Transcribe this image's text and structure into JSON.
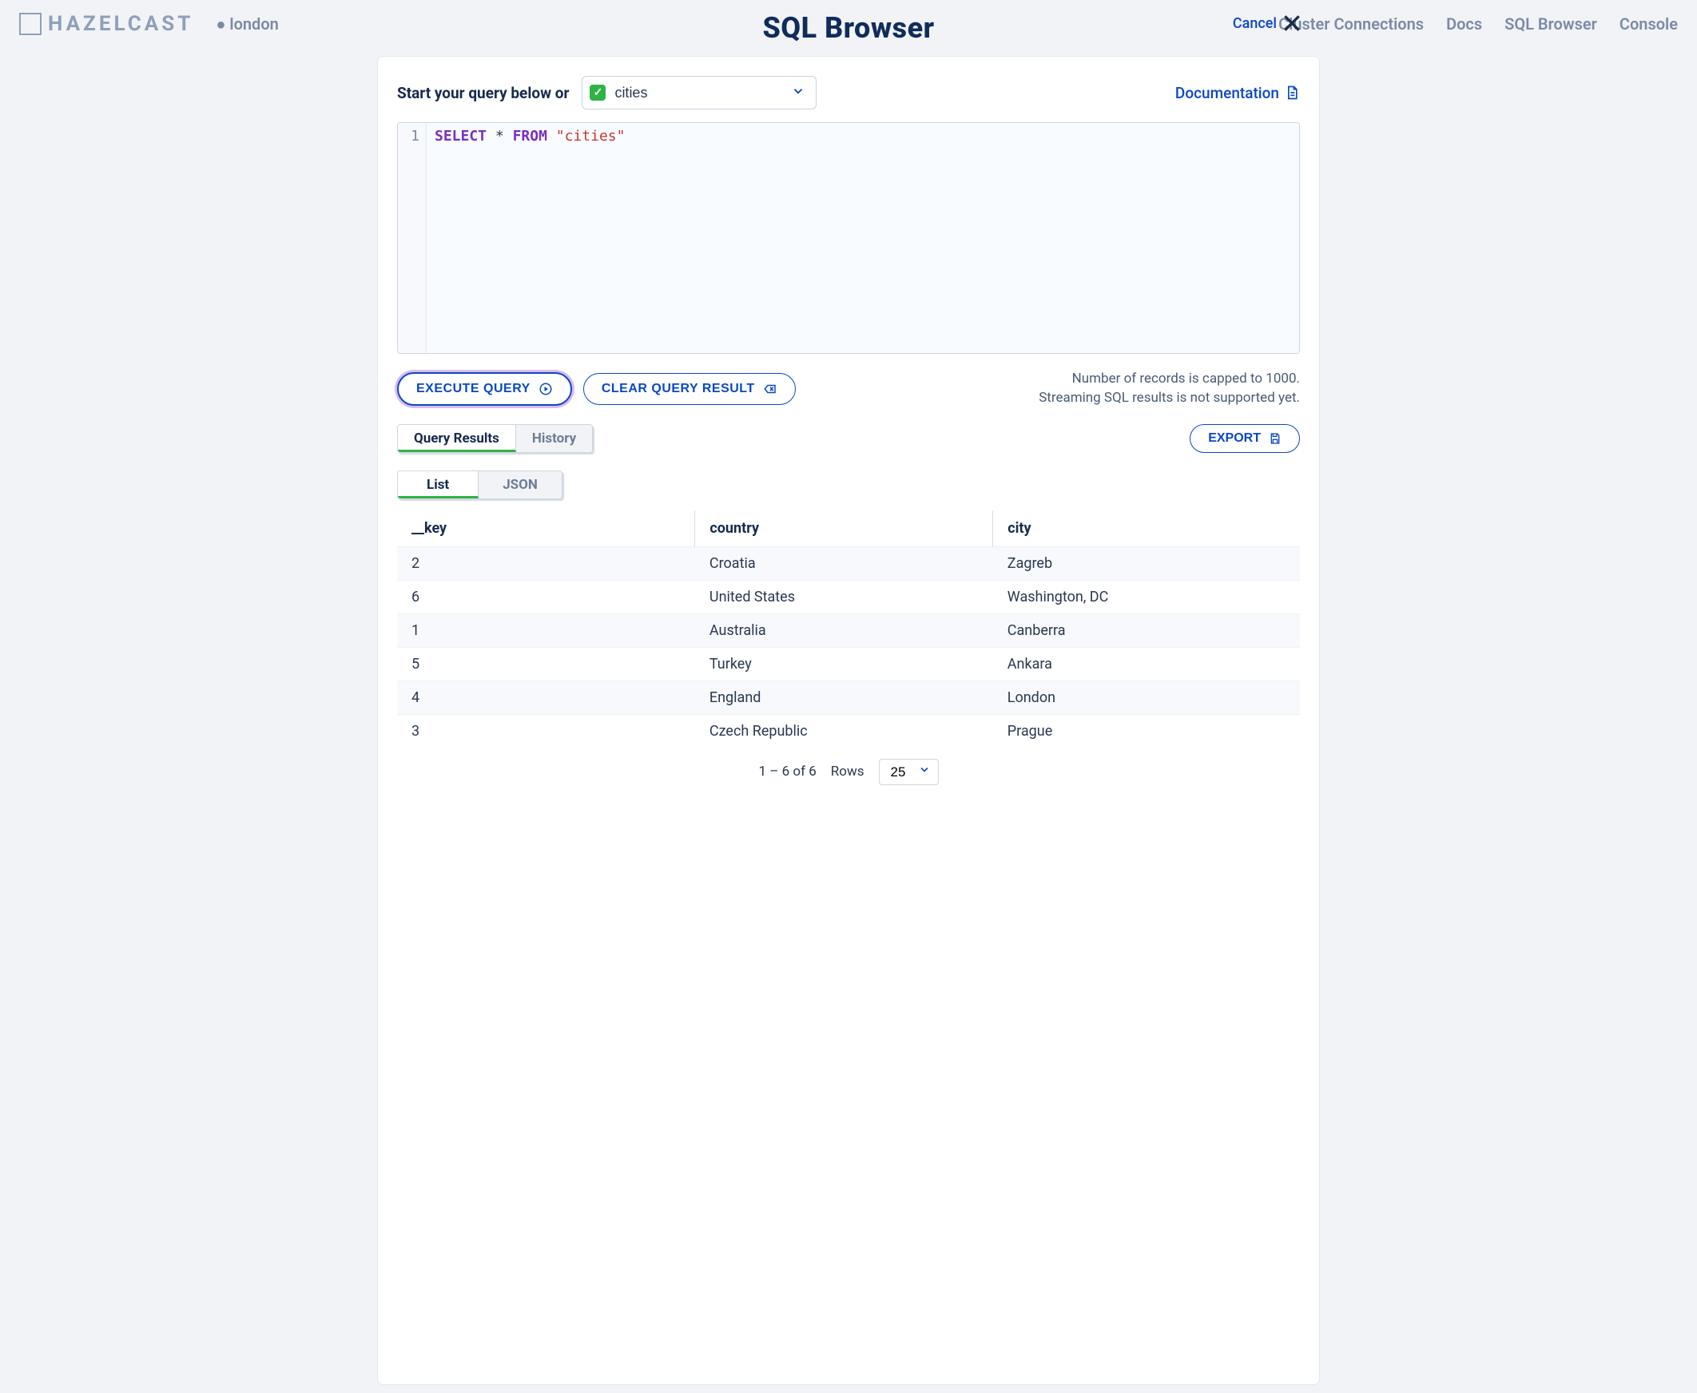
{
  "background": {
    "brand": "HAZELCAST",
    "cluster": "london",
    "nav": {
      "connections": "Cluster Connections",
      "docs": "Docs",
      "sql": "SQL Browser",
      "console": "Console"
    }
  },
  "modal": {
    "title": "SQL Browser",
    "cancel": "Cancel"
  },
  "query_row": {
    "label": "Start your query below or",
    "selected_map": "cities",
    "doc_link": "Documentation"
  },
  "editor": {
    "line_no": "1",
    "tokens": {
      "select": "SELECT",
      "star": "*",
      "from": "FROM",
      "str": "\"cities\""
    }
  },
  "actions": {
    "execute": "EXECUTE QUERY",
    "clear": "CLEAR QUERY RESULT",
    "note_line1": "Number of records is capped to 1000.",
    "note_line2": "Streaming SQL results is not supported yet."
  },
  "tabs_primary": {
    "results": "Query Results",
    "history": "History"
  },
  "export_label": "EXPORT",
  "tabs_view": {
    "list": "List",
    "json": "JSON"
  },
  "columns": {
    "key": "__key",
    "country": "country",
    "city": "city"
  },
  "rows": [
    {
      "key": "2",
      "country": "Croatia",
      "city": "Zagreb"
    },
    {
      "key": "6",
      "country": "United States",
      "city": "Washington, DC"
    },
    {
      "key": "1",
      "country": "Australia",
      "city": "Canberra"
    },
    {
      "key": "5",
      "country": "Turkey",
      "city": "Ankara"
    },
    {
      "key": "4",
      "country": "England",
      "city": "London"
    },
    {
      "key": "3",
      "country": "Czech Republic",
      "city": "Prague"
    }
  ],
  "pager": {
    "range": "1 – 6 of 6",
    "rows_label": "Rows",
    "rows_value": "25"
  }
}
